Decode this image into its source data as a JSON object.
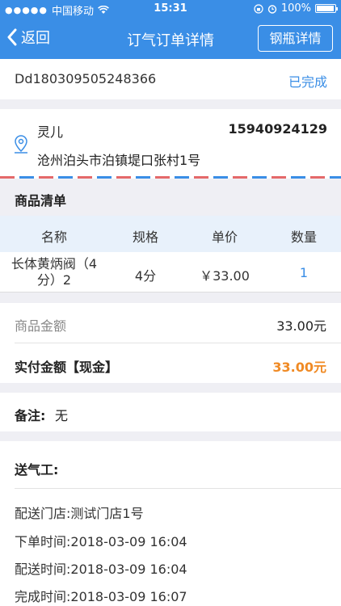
{
  "status_bar": {
    "carrier": "中国移动",
    "time": "15:31",
    "battery": "100%"
  },
  "nav": {
    "back_label": "返回",
    "title": "订气订单详情",
    "right_button": "钢瓶详情"
  },
  "order": {
    "number": "Dd180309505248366",
    "status": "已完成"
  },
  "customer": {
    "name": "灵儿",
    "phone": "15940924129",
    "address": "沧州泊头市泊镇堤口张村1号"
  },
  "goods": {
    "section_title": "商品清单",
    "columns": [
      "名称",
      "规格",
      "单价",
      "数量"
    ],
    "rows": [
      {
        "name": "长体黄炳阀（4分）2",
        "spec": "4分",
        "price": "￥33.00",
        "qty": "1"
      }
    ]
  },
  "amounts": {
    "goods_label": "商品金额",
    "goods_value": "33.00元",
    "paid_label": "实付金额【现金】",
    "paid_value": "33.00元"
  },
  "note": {
    "label": "备注:",
    "value": "无"
  },
  "delivery": {
    "title": "送气工:",
    "store": "配送门店:测试门店1号",
    "order_time": "下单时间:2018-03-09 16:04",
    "delivery_time": "配送时间:2018-03-09 16:04",
    "complete_time": "完成时间:2018-03-09 16:07"
  }
}
